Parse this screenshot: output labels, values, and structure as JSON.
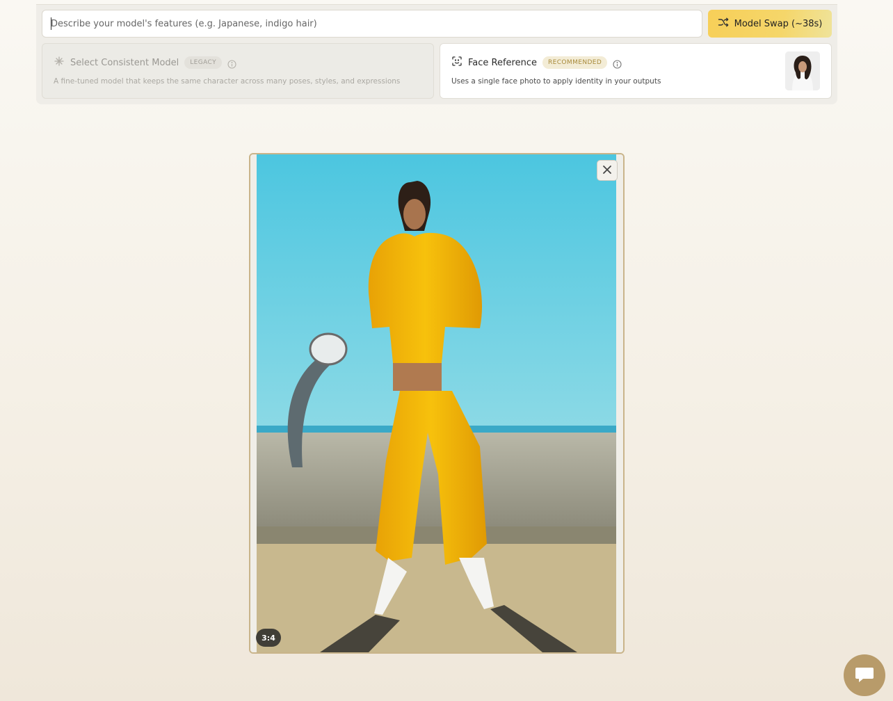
{
  "prompt": {
    "placeholder": "Describe your model's features (e.g. Japanese, indigo hair)",
    "value": ""
  },
  "swap_button": {
    "label": "Model Swap (~38s)",
    "icon": "shuffle-icon"
  },
  "options": {
    "consistent_model": {
      "title": "Select Consistent Model",
      "badge": "LEGACY",
      "description": "A fine-tuned model that keeps the same character across many poses, styles, and expressions",
      "icon": "sparkle-icon",
      "enabled": false
    },
    "face_reference": {
      "title": "Face Reference",
      "badge": "RECOMMENDED",
      "description": "Uses a single face photo to apply identity in your outputs",
      "icon": "face-scan-icon",
      "enabled": true
    }
  },
  "preview": {
    "aspect_ratio": "3:4",
    "colors": {
      "frame_border": "#c9b48a",
      "accent": "#f7cf58"
    }
  },
  "chat": {
    "icon": "chat-bubble-icon",
    "color": "#b89b6a"
  }
}
